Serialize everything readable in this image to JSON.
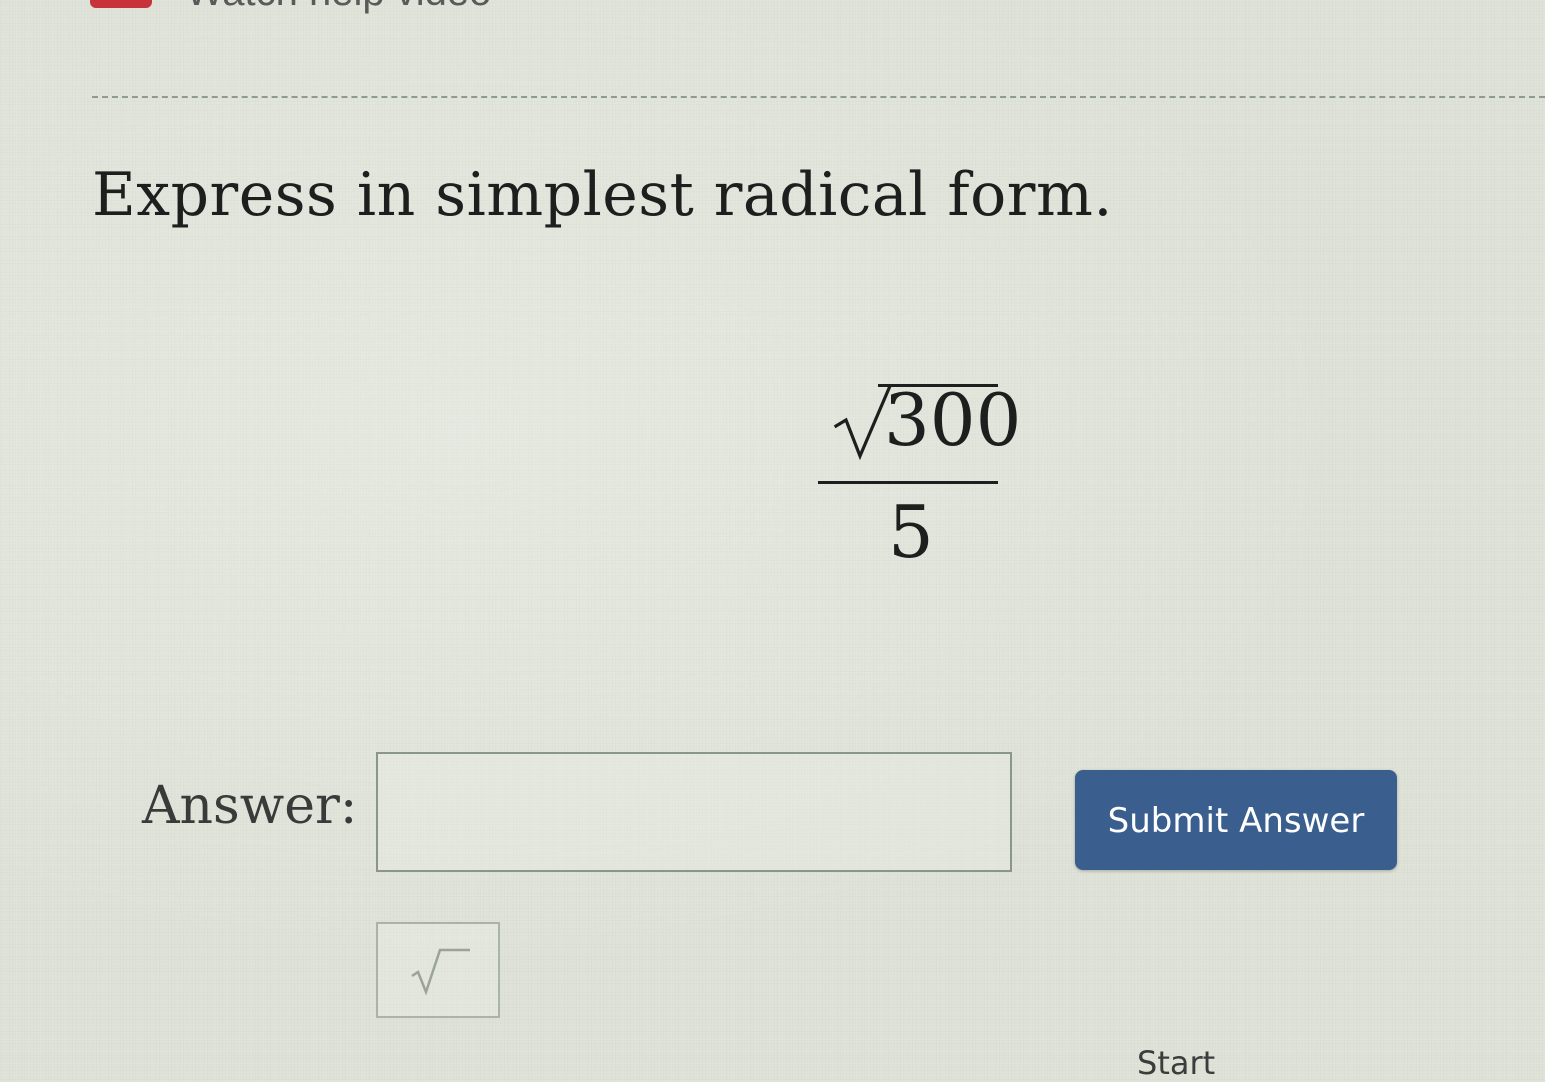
{
  "header": {
    "title": "Watch help video",
    "icon": "video-play-icon",
    "icon_color": "#c8323a"
  },
  "question": {
    "prompt": "Express in simplest radical form.",
    "expression": {
      "radicand": "300",
      "denominator": "5"
    }
  },
  "answer": {
    "label": "Answer:",
    "value": "",
    "placeholder": ""
  },
  "submit_button": {
    "label": "Submit Answer",
    "color": "#3a5f8f"
  },
  "tools": {
    "sqrt_icon": "square-root-icon"
  },
  "footer": {
    "start_label": "Start"
  }
}
